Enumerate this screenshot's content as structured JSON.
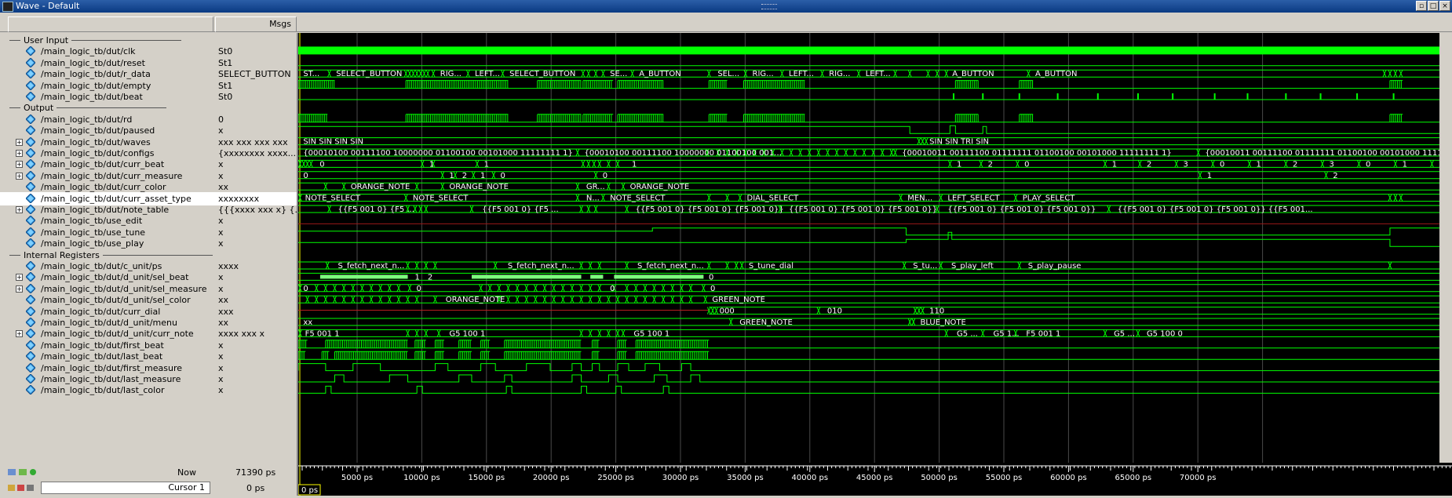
{
  "window": {
    "title": "Wave - Default"
  },
  "header": {
    "msgs": "Msgs"
  },
  "groups": [
    {
      "label": "User Input",
      "row": 0
    },
    {
      "label": "Output",
      "row": 6
    },
    {
      "label": "Internal Registers",
      "row": 19
    }
  ],
  "signals": [
    {
      "name": "/main_logic_tb/dut/clk",
      "value": "St0",
      "row": 1,
      "expand": false,
      "kind": "clk"
    },
    {
      "name": "/main_logic_tb/dut/reset",
      "value": "St1",
      "row": 2,
      "expand": false,
      "kind": "low"
    },
    {
      "name": "/main_logic_tb/dut/r_data",
      "value": "SELECT_BUTTON",
      "row": 3,
      "expand": false,
      "kind": "bus",
      "labels": [
        [
          2,
          "ST..."
        ],
        [
          38,
          "SELECT_BUTTON"
        ],
        [
          152,
          "RIG..."
        ],
        [
          190,
          "LEFT..."
        ],
        [
          228,
          "SELECT_BUTTON"
        ],
        [
          338,
          "SE..."
        ],
        [
          370,
          "A_BUTTON"
        ],
        [
          456,
          "SEL..."
        ],
        [
          494,
          "RIG..."
        ],
        [
          534,
          "LEFT..."
        ],
        [
          578,
          "RIG..."
        ],
        [
          618,
          "LEFT..."
        ],
        [
          713,
          "A_BUTTON"
        ],
        [
          804,
          "A_BUTTON"
        ]
      ],
      "edges": [
        34,
        118,
        122,
        126,
        130,
        134,
        138,
        142,
        148,
        186,
        224,
        312,
        318,
        326,
        334,
        366,
        450,
        490,
        530,
        574,
        614,
        654,
        670,
        690,
        700,
        710,
        800,
        1190,
        1196,
        1202,
        1208
      ]
    },
    {
      "name": "/main_logic_tb/dut/empty",
      "value": "St1",
      "row": 4,
      "expand": false,
      "kind": "pulses",
      "segments": [
        [
          0,
          40
        ],
        [
          118,
          230
        ],
        [
          262,
          310
        ],
        [
          312,
          345
        ],
        [
          350,
          400
        ],
        [
          450,
          470
        ],
        [
          488,
          555
        ],
        [
          720,
          745
        ],
        [
          790,
          805
        ],
        [
          1196,
          1210
        ]
      ]
    },
    {
      "name": "/main_logic_tb/dut/beat",
      "value": "St0",
      "row": 5,
      "expand": false,
      "kind": "beat",
      "ticks": [
        718,
        750,
        790,
        832,
        876,
        920,
        958,
        1004,
        1040,
        1082,
        1120,
        1160,
        1200
      ]
    },
    {
      "name": "/main_logic_tb/dut/rd",
      "value": "0",
      "row": 7,
      "expand": false,
      "kind": "pulses",
      "segments": [
        [
          0,
          32
        ],
        [
          118,
          230
        ],
        [
          262,
          310
        ],
        [
          312,
          345
        ],
        [
          350,
          400
        ],
        [
          450,
          470
        ],
        [
          488,
          555
        ],
        [
          720,
          745
        ],
        [
          790,
          805
        ],
        [
          1196,
          1210
        ]
      ]
    },
    {
      "name": "/main_logic_tb/dut/paused",
      "value": "x",
      "row": 8,
      "expand": false,
      "kind": "paused"
    },
    {
      "name": "/main_logic_tb/dut/waves",
      "value": "xxx xxx xxx xxx",
      "row": 9,
      "expand": true,
      "kind": "bus",
      "labels": [
        [
          2,
          "SIN SIN SIN SIN"
        ],
        [
          688,
          "SIN SIN TRI SIN"
        ]
      ],
      "edges": [
        680,
        684,
        688
      ]
    },
    {
      "name": "/main_logic_tb/dut/configs",
      "value": "{xxxxxxxx xxxx...",
      "row": 10,
      "expand": true,
      "kind": "bus",
      "labels": [
        [
          2,
          "{00010100 00111100 10000000 01100100 00101000 11111111 1}"
        ],
        [
          310,
          "{00010100 00111100 10000000 01100100 001..."
        ],
        [
          658,
          "{00010011 00111100 01111111 01100100 00101000 11111111 1}"
        ],
        [
          990,
          "{00010011 00111100 01111111 01100100 00101000 11111111 1..."
        ]
      ],
      "edges": [
        306,
        448,
        460,
        470,
        480,
        490,
        500,
        510,
        520,
        530,
        540,
        550,
        560,
        570,
        580,
        590,
        600,
        610,
        620,
        630,
        640,
        650,
        654,
        986
      ]
    },
    {
      "name": "/main_logic_tb/dut/curr_beat",
      "value": "x",
      "row": 11,
      "expand": true,
      "kind": "bus",
      "labels": [
        [
          20,
          "0"
        ],
        [
          140,
          "1"
        ],
        [
          200,
          "1"
        ],
        [
          362,
          "1"
        ],
        [
          718,
          "1"
        ],
        [
          752,
          "2"
        ],
        [
          792,
          "0"
        ],
        [
          888,
          "1"
        ],
        [
          926,
          "2"
        ],
        [
          966,
          "3"
        ],
        [
          1006,
          "0"
        ],
        [
          1046,
          "1"
        ],
        [
          1086,
          "2"
        ],
        [
          1126,
          "3"
        ],
        [
          1166,
          "0"
        ],
        [
          1206,
          "1"
        ],
        [
          1246,
          "2"
        ]
      ],
      "edges": [
        2,
        6,
        10,
        14,
        136,
        148,
        196,
        312,
        318,
        324,
        330,
        340,
        350,
        714,
        748,
        788,
        884,
        922,
        962,
        1002,
        1042,
        1082,
        1122,
        1162,
        1202,
        1242
      ]
    },
    {
      "name": "/main_logic_tb/dut/curr_measure",
      "value": "x",
      "row": 12,
      "expand": true,
      "kind": "bus",
      "labels": [
        [
          2,
          "0"
        ],
        [
          162,
          "1"
        ],
        [
          176,
          "2"
        ],
        [
          196,
          "1"
        ],
        [
          218,
          "0"
        ],
        [
          330,
          "0"
        ],
        [
          992,
          "1"
        ],
        [
          1130,
          "2"
        ]
      ],
      "edges": [
        158,
        172,
        192,
        214,
        326,
        988,
        1126
      ]
    },
    {
      "name": "/main_logic_tb/dut/curr_color",
      "value": "xx",
      "row": 13,
      "expand": false,
      "kind": "bus",
      "labels": [
        [
          54,
          "ORANGE_NOTE"
        ],
        [
          162,
          "ORANGE_NOTE"
        ],
        [
          312,
          "GR..."
        ],
        [
          360,
          "ORANGE_NOTE"
        ]
      ],
      "edges": [
        30,
        50,
        130,
        158,
        306,
        340,
        356
      ]
    },
    {
      "name": "/main_logic_tb/dut/curr_asset_type",
      "value": "xxxxxxxx",
      "row": 14,
      "expand": false,
      "kind": "bus",
      "selected": true,
      "labels": [
        [
          4,
          "NOTE_SELECT"
        ],
        [
          122,
          "NOTE_SELECT"
        ],
        [
          312,
          "N..."
        ],
        [
          338,
          "NOTE_SELECT"
        ],
        [
          488,
          "DIAL_SELECT"
        ],
        [
          664,
          "MEN..."
        ],
        [
          708,
          "LEFT_SELECT"
        ],
        [
          790,
          "PLAY_SELECT"
        ]
      ],
      "edges": [
        2,
        118,
        306,
        334,
        450,
        470,
        484,
        660,
        704,
        786,
        1196,
        1202,
        1208
      ]
    },
    {
      "name": "/main_logic_tb/dut/note_table",
      "value": "{{{xxxx xxx x} {...",
      "row": 15,
      "expand": true,
      "kind": "bus",
      "labels": [
        [
          40,
          "{{F5 001 0} {F5 ..."
        ],
        [
          198,
          "{{F5 001 0} {F5 ..."
        ],
        [
          366,
          "{{F5 001 0} {F5 001 0} {F5 001 0}}"
        ],
        [
          534,
          "{{F5 001 0} {F5 001 0} {F5 001 0}}"
        ],
        [
          708,
          "{{F5 001 0} {F5 001 0} {F5 001 0}}"
        ],
        [
          894,
          "{{F5 001 0} {F5 001 0} {F5 001 0}} {{F5 001..."
        ]
      ],
      "edges": [
        34,
        120,
        128,
        134,
        140,
        190,
        310,
        318,
        326,
        360,
        528,
        700,
        888
      ]
    },
    {
      "name": "/main_logic_tb/use_edit",
      "value": "x",
      "row": 16,
      "expand": false,
      "kind": "use_edit"
    },
    {
      "name": "/main_logic_tb/use_tune",
      "value": "x",
      "row": 17,
      "expand": false,
      "kind": "use_tune"
    },
    {
      "name": "/main_logic_tb/use_play",
      "value": "x",
      "row": 18,
      "expand": false,
      "kind": "use_play"
    },
    {
      "name": "/main_logic_tb/dut/c_unit/ps",
      "value": "xxxx",
      "row": 20,
      "expand": false,
      "kind": "bus",
      "labels": [
        [
          40,
          "S_fetch_next_n..."
        ],
        [
          226,
          "S_fetch_next_n..."
        ],
        [
          368,
          "S_fetch_next_n..."
        ],
        [
          490,
          "S_tune_dial"
        ],
        [
          670,
          "S_tu..."
        ],
        [
          712,
          "S_play_left"
        ],
        [
          796,
          "S_play_pause"
        ]
      ],
      "edges": [
        32,
        120,
        130,
        140,
        150,
        216,
        310,
        320,
        330,
        360,
        450,
        470,
        480,
        486,
        664,
        704,
        790,
        1196
      ]
    },
    {
      "name": "/main_logic_tb/dut/d_unit/sel_beat",
      "value": "x",
      "row": 21,
      "expand": true,
      "kind": "selbeat",
      "labels": [
        [
          126,
          "1"
        ],
        [
          140,
          "2"
        ],
        [
          448,
          "0"
        ]
      ]
    },
    {
      "name": "/main_logic_tb/dut/d_unit/sel_measure",
      "value": "x",
      "row": 22,
      "expand": true,
      "kind": "bus",
      "labels": [
        [
          2,
          "0"
        ],
        [
          126,
          "0"
        ],
        [
          338,
          "0"
        ],
        [
          448,
          "0"
        ]
      ],
      "edges": [
        2,
        20,
        30,
        40,
        50,
        60,
        70,
        80,
        90,
        100,
        110,
        122,
        200,
        210,
        220,
        230,
        240,
        250,
        260,
        270,
        280,
        290,
        300,
        310,
        320,
        330,
        346,
        360,
        370,
        380,
        390,
        400,
        410,
        420,
        430,
        444
      ]
    },
    {
      "name": "/main_logic_tb/dut/d_unit/sel_color",
      "value": "xx",
      "row": 23,
      "expand": false,
      "kind": "bus",
      "labels": [
        [
          158,
          "ORANGE_NOTE"
        ],
        [
          450,
          "GREEN_NOTE"
        ]
      ],
      "edges": [
        10,
        20,
        30,
        40,
        50,
        60,
        70,
        80,
        90,
        100,
        110,
        120,
        130,
        150,
        220,
        230,
        240,
        250,
        260,
        270,
        280,
        290,
        300,
        310,
        320,
        330,
        340,
        350,
        360,
        370,
        380,
        390,
        400,
        410,
        420,
        430,
        446
      ]
    },
    {
      "name": "/main_logic_tb/dut/curr_dial",
      "value": "xxx",
      "row": 24,
      "expand": false,
      "kind": "dial",
      "labels": [
        [
          458,
          "000"
        ],
        [
          576,
          "010"
        ],
        [
          688,
          "110"
        ]
      ],
      "edges": [
        450,
        454,
        458,
        570,
        676,
        680,
        684
      ]
    },
    {
      "name": "/main_logic_tb/dut/d_unit/menu",
      "value": "xx",
      "row": 25,
      "expand": false,
      "kind": "bus",
      "labels": [
        [
          2,
          "xx"
        ],
        [
          480,
          "GREEN_NOTE"
        ],
        [
          678,
          "BLUE_NOTE"
        ]
      ],
      "edges": [
        474,
        670,
        674
      ]
    },
    {
      "name": "/main_logic_tb/dut/d_unit/curr_note",
      "value": "xxxx xxx x",
      "row": 26,
      "expand": true,
      "kind": "bus",
      "labels": [
        [
          4,
          "F5 001 1"
        ],
        [
          162,
          "G5 100 1"
        ],
        [
          364,
          "G5 100 1"
        ],
        [
          718,
          "G5 ..."
        ],
        [
          758,
          "G5 1..."
        ],
        [
          794,
          "F5 001 1"
        ],
        [
          890,
          "G5 ..."
        ],
        [
          926,
          "G5 100 0"
        ]
      ],
      "edges": [
        2,
        120,
        130,
        140,
        154,
        310,
        320,
        330,
        340,
        350,
        356,
        710,
        750,
        786,
        884,
        920
      ]
    },
    {
      "name": "/main_logic_tb/dut/first_beat",
      "value": "x",
      "row": 27,
      "expand": false,
      "kind": "pulses",
      "segments": [
        [
          0,
          10
        ],
        [
          30,
          120
        ],
        [
          128,
          140
        ],
        [
          150,
          160
        ],
        [
          176,
          190
        ],
        [
          200,
          210
        ],
        [
          226,
          310
        ],
        [
          322,
          330
        ],
        [
          350,
          360
        ],
        [
          370,
          450
        ]
      ]
    },
    {
      "name": "/main_logic_tb/dut/last_beat",
      "value": "x",
      "row": 28,
      "expand": false,
      "kind": "pulses",
      "segments": [
        [
          0,
          8
        ],
        [
          26,
          34
        ],
        [
          40,
          120
        ],
        [
          128,
          140
        ],
        [
          150,
          160
        ],
        [
          176,
          190
        ],
        [
          200,
          210
        ],
        [
          226,
          310
        ],
        [
          322,
          330
        ],
        [
          350,
          360
        ],
        [
          370,
          450
        ]
      ]
    },
    {
      "name": "/main_logic_tb/dut/first_measure",
      "value": "x",
      "row": 29,
      "expand": false,
      "kind": "sq",
      "segments": [
        [
          0,
          30
        ],
        [
          60,
          90
        ],
        [
          150,
          164
        ],
        [
          200,
          216
        ],
        [
          250,
          276
        ],
        [
          300,
          310
        ],
        [
          322,
          330
        ],
        [
          350,
          362
        ],
        [
          380,
          396
        ],
        [
          420,
          430
        ]
      ]
    },
    {
      "name": "/main_logic_tb/dut/last_measure",
      "value": "x",
      "row": 30,
      "expand": false,
      "kind": "sq",
      "segments": [
        [
          40,
          50
        ],
        [
          100,
          120
        ],
        [
          176,
          190
        ],
        [
          226,
          234
        ],
        [
          300,
          310
        ],
        [
          340,
          350
        ],
        [
          390,
          404
        ],
        [
          430,
          440
        ]
      ]
    },
    {
      "name": "/main_logic_tb/dut/last_color",
      "value": "x",
      "row": 31,
      "expand": false,
      "kind": "sq",
      "segments": [
        [
          30,
          36
        ],
        [
          130,
          136
        ],
        [
          228,
          234
        ],
        [
          310,
          316
        ],
        [
          348,
          354
        ],
        [
          400,
          406
        ]
      ]
    }
  ],
  "status": {
    "now_label": "Now",
    "now_value": "71390 ps",
    "cursor_label": "Cursor 1",
    "cursor_value": "0 ps",
    "cursor_flag": "0 ps"
  },
  "timeline": {
    "ticks": [
      "5000 ps",
      "10000 ps",
      "15000 ps",
      "20000 ps",
      "25000 ps",
      "30000 ps",
      "35000 ps",
      "40000 ps",
      "45000 ps",
      "50000 ps",
      "55000 ps",
      "60000 ps",
      "65000 ps",
      "70000 ps"
    ]
  },
  "colors": {
    "trace": "#00ff00",
    "text": "#ffffff",
    "grid": "#4a4a4a",
    "cursor": "#ffff00"
  }
}
